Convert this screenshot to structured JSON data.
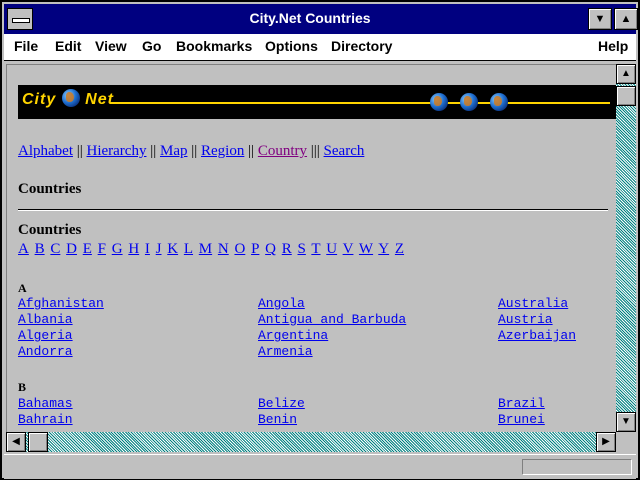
{
  "window": {
    "title": "City.Net Countries"
  },
  "menu": [
    {
      "label": "File"
    },
    {
      "label": "Edit"
    },
    {
      "label": "View"
    },
    {
      "label": "Go"
    },
    {
      "label": "Bookmarks"
    },
    {
      "label": "Options"
    },
    {
      "label": "Directory"
    },
    {
      "label": "Help"
    }
  ],
  "banner": {
    "logo": "City",
    "logo2": "Net"
  },
  "nav": [
    "Alphabet",
    "Hierarchy",
    "Map",
    "Region",
    "Country",
    "Search"
  ],
  "heading": "Countries",
  "subheading": "Countries",
  "letters": [
    "A",
    "B",
    "C",
    "D",
    "E",
    "F",
    "G",
    "H",
    "I",
    "J",
    "K",
    "L",
    "M",
    "N",
    "O",
    "P",
    "Q",
    "R",
    "S",
    "T",
    "U",
    "V",
    "W",
    "Y",
    "Z"
  ],
  "sections": {
    "a": {
      "label": "A",
      "col1": [
        "Afghanistan",
        "Albania",
        "Algeria",
        "Andorra"
      ],
      "col2": [
        "Angola",
        "Antigua and Barbuda",
        "Argentina",
        "Armenia"
      ],
      "col3": [
        "Australia",
        "Austria",
        "Azerbaijan"
      ]
    },
    "b": {
      "label": "B",
      "col1": [
        "Bahamas",
        "Bahrain"
      ],
      "col2": [
        "Belize",
        "Benin"
      ],
      "col3": [
        "Brazil",
        "Brunei"
      ]
    }
  },
  "scroll": {
    "up": "▲",
    "down": "▼",
    "left": "◀",
    "right": "▶"
  }
}
